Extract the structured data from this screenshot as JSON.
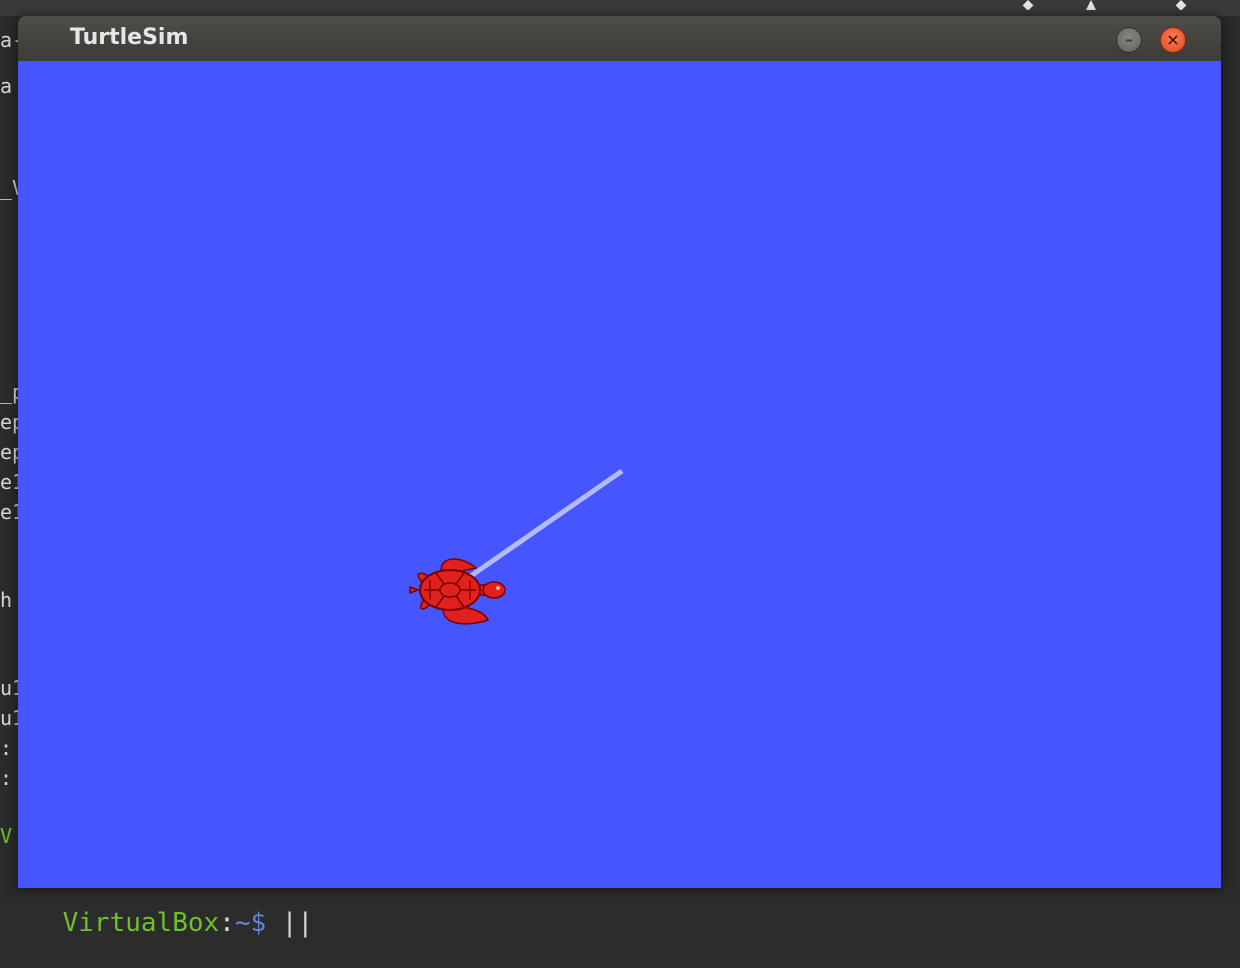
{
  "window": {
    "title": "TurtleSim",
    "minimize_glyph": "–",
    "close_glyph": "×"
  },
  "canvas": {
    "background_color": "#4556ff",
    "pen_color": "#b4baff"
  },
  "turtle": {
    "icon": "turtle-icon",
    "color": "#e0211d"
  },
  "terminal": {
    "lines": [
      "a-",
      "a",
      "_V",
      "_p",
      "ep",
      "ep",
      "e1",
      "e1",
      "h",
      "u1",
      "u1",
      ":",
      ":",
      "V"
    ],
    "prompt_host": "VirtualBox",
    "prompt_sep": ":",
    "prompt_path": "~$",
    "prompt_cursor": " ||"
  }
}
